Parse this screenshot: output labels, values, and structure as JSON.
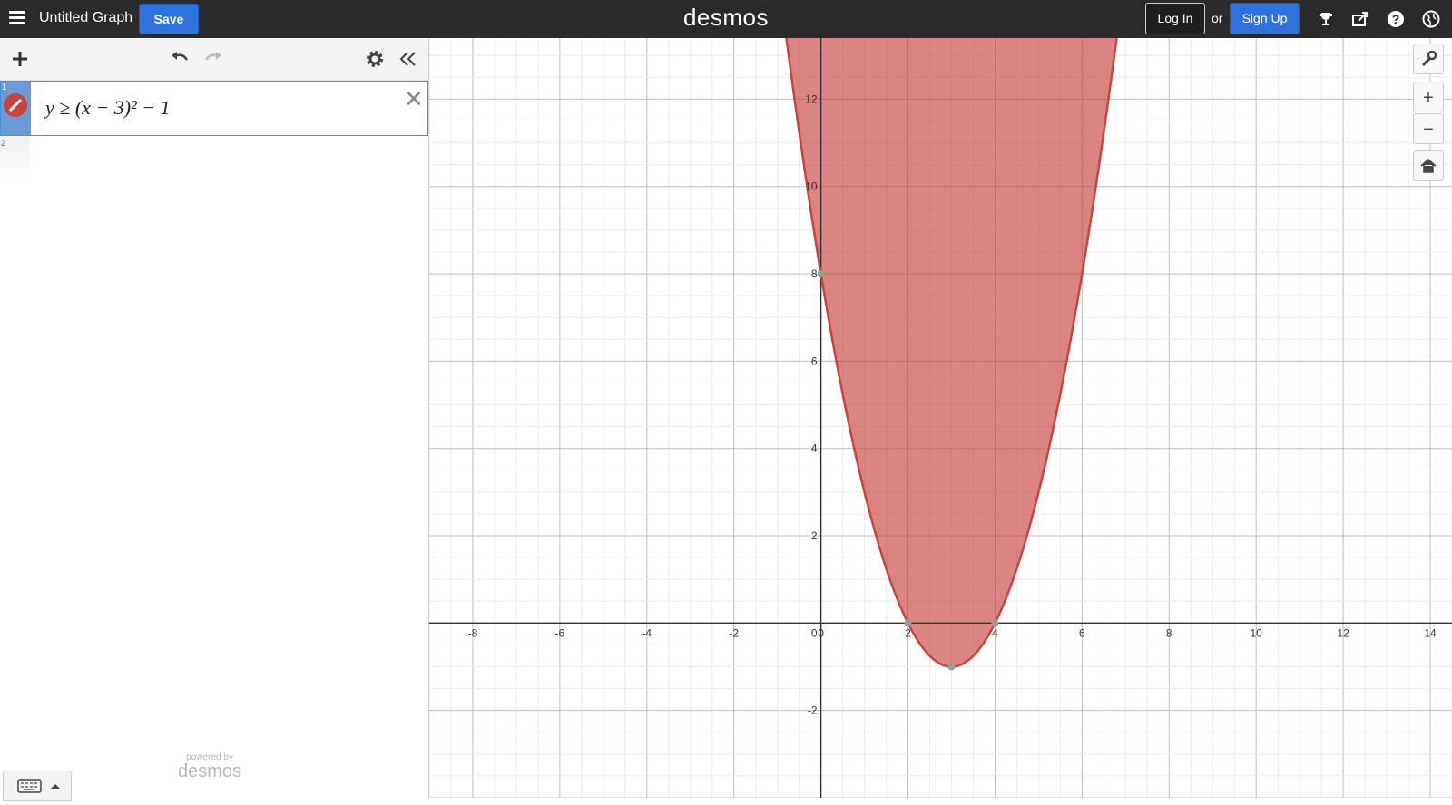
{
  "topbar": {
    "graph_title": "Untitled Graph",
    "save_label": "Save",
    "logo": "desmos",
    "login_label": "Log In",
    "or_text": "or",
    "signup_label": "Sign Up",
    "icons": [
      "menu-icon",
      "trophy-icon",
      "share-icon",
      "help-icon",
      "globe-icon"
    ]
  },
  "expressions": [
    {
      "number": "1",
      "latex": "y ≥ (x − 3)² − 1",
      "color": "#c74440"
    },
    {
      "number": "2",
      "latex": ""
    }
  ],
  "branding": {
    "powered_by": "powered by",
    "logo": "desmos"
  },
  "graph_controls": {
    "zoom_in": "+",
    "zoom_out": "−"
  },
  "chart_data": {
    "type": "area",
    "function": "y >= (x-3)^2 - 1",
    "xlim": [
      -9,
      14.5
    ],
    "ylim": [
      -4,
      13.4
    ],
    "x_ticks": [
      -8,
      -6,
      -4,
      -2,
      0,
      2,
      4,
      6,
      8,
      10,
      12,
      14
    ],
    "y_ticks": [
      -2,
      2,
      4,
      6,
      8,
      10,
      12
    ],
    "points_of_interest": [
      {
        "x": 0,
        "y": 8
      },
      {
        "x": 2,
        "y": 0
      },
      {
        "x": 4,
        "y": 0
      },
      {
        "x": 3,
        "y": -1
      }
    ],
    "fill_color": "#c74440",
    "grid": true
  }
}
